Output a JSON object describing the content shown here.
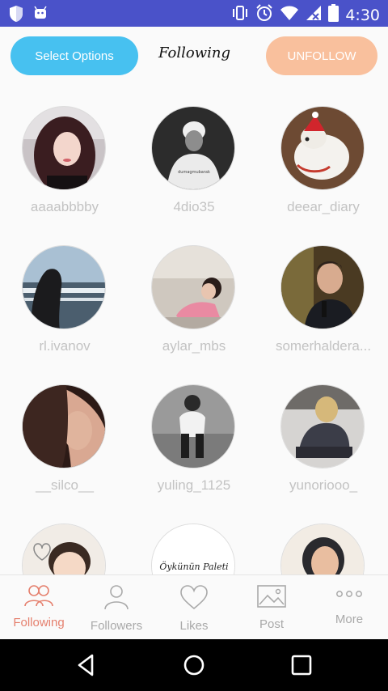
{
  "status_bar": {
    "time": "4:30",
    "left_icons": [
      "shield-icon",
      "android-icon"
    ],
    "right_icons": [
      "vibrate-icon",
      "alarm-icon",
      "wifi-icon",
      "signal-icon",
      "battery-icon"
    ]
  },
  "topbar": {
    "select_label": "Select Options",
    "title": "Following",
    "unfollow_label": "UNFOLLOW",
    "colors": {
      "select": "#47c1f0",
      "unfollow": "#f9c09d"
    }
  },
  "users": [
    {
      "name": "aaaabbbby"
    },
    {
      "name": "4dio35"
    },
    {
      "name": "deear_diary"
    },
    {
      "name": "rl.ivanov"
    },
    {
      "name": "aylar_mbs"
    },
    {
      "name": "somerhaldera..."
    },
    {
      "name": "__silco__"
    },
    {
      "name": "yuling_1125"
    },
    {
      "name": "yunoriooo_"
    },
    {
      "name": ""
    },
    {
      "name": ""
    },
    {
      "name": ""
    }
  ],
  "avatar_texts": {
    "watermark": "dumagmubarak",
    "handwriting": "Öykünün Paleti"
  },
  "tabs": [
    {
      "label": "Following",
      "icon": "people-icon",
      "active": true
    },
    {
      "label": "Followers",
      "icon": "person-icon",
      "active": false
    },
    {
      "label": "Likes",
      "icon": "heart-icon",
      "active": false
    },
    {
      "label": "Post",
      "icon": "image-icon",
      "active": false
    },
    {
      "label": "More",
      "icon": "more-icon",
      "active": false
    }
  ],
  "navbar": [
    "back-icon",
    "home-icon",
    "recents-icon"
  ]
}
